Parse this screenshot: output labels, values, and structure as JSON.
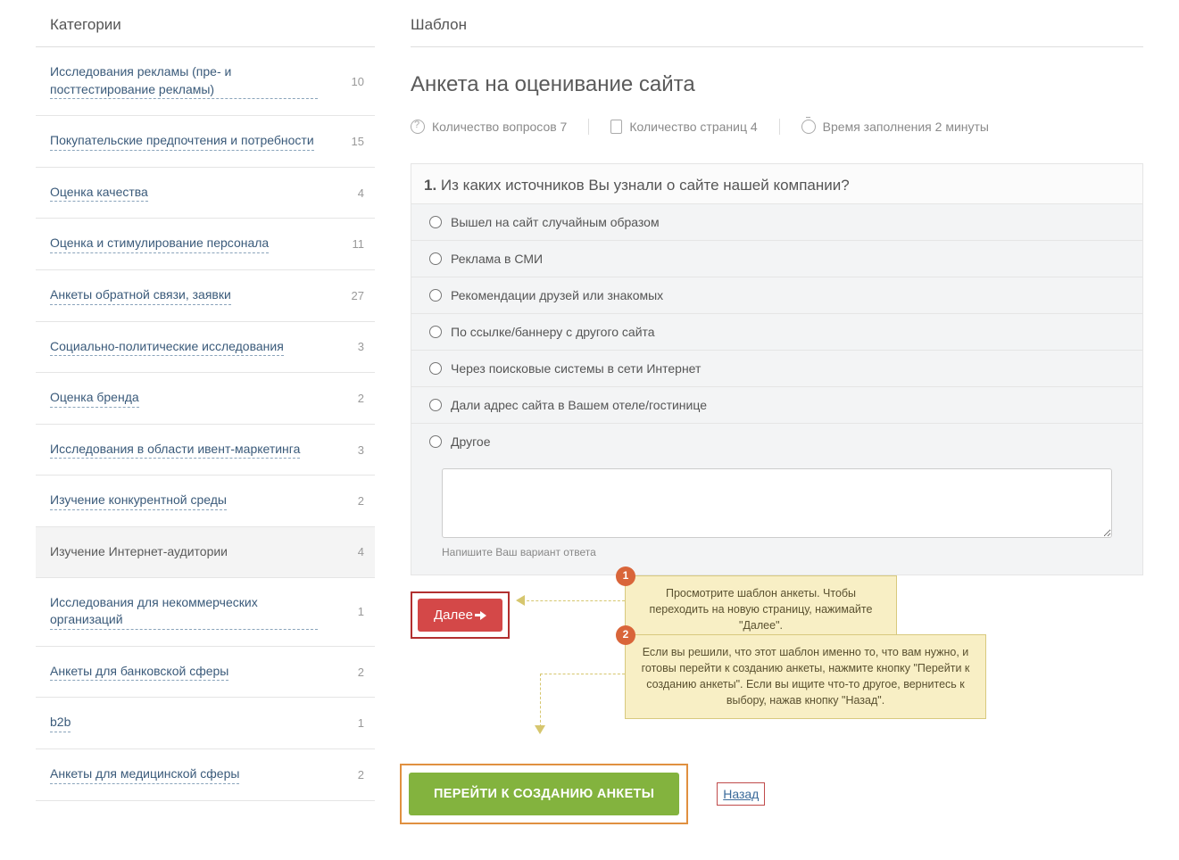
{
  "sidebar": {
    "title": "Категории",
    "items": [
      {
        "label": "Исследования рекламы (пре- и посттестирование рекламы)",
        "count": "10"
      },
      {
        "label": "Покупательские предпочтения и потребности",
        "count": "15"
      },
      {
        "label": "Оценка качества",
        "count": "4"
      },
      {
        "label": "Оценка и стимулирование персонала",
        "count": "11"
      },
      {
        "label": "Анкеты обратной связи, заявки",
        "count": "27"
      },
      {
        "label": "Социально-политические исследования",
        "count": "3"
      },
      {
        "label": "Оценка бренда",
        "count": "2"
      },
      {
        "label": "Исследования в области ивент-маркетинга",
        "count": "3"
      },
      {
        "label": "Изучение конкурентной среды",
        "count": "2"
      },
      {
        "label": "Изучение Интернет-аудитории",
        "count": "4"
      },
      {
        "label": "Исследования для некоммерческих организаций",
        "count": "1"
      },
      {
        "label": "Анкеты для банковской сферы",
        "count": "2"
      },
      {
        "label": "b2b",
        "count": "1"
      },
      {
        "label": "Анкеты для медицинской сферы",
        "count": "2"
      }
    ],
    "selected_index": 9
  },
  "main": {
    "section_title": "Шаблон",
    "title": "Анкета на оценивание сайта",
    "meta": {
      "questions_label": "Количество вопросов 7",
      "pages_label": "Количество страниц 4",
      "time_label": "Время заполнения 2 минуты"
    },
    "question": {
      "number": "1.",
      "text": "Из каких источников Вы узнали о сайте нашей компании?",
      "options": [
        "Вышел на сайт случайным образом",
        "Реклама в СМИ",
        "Рекомендации друзей или знакомых",
        "По ссылке/баннеру с другого сайта",
        "Через поисковые системы в сети Интернет",
        "Дали адрес сайта в Вашем отеле/гостинице",
        "Другое"
      ],
      "other_hint": "Напишите Ваш вариант ответа"
    },
    "next_label": "Далее",
    "create_label": "ПЕРЕЙТИ К СОЗДАНИЮ АНКЕТЫ",
    "back_label": "Назад",
    "callouts": {
      "b1": "1",
      "t1": "Просмотрите шаблон анкеты. Чтобы переходить на новую страницу, нажимайте \"Далее\".",
      "b2": "2",
      "t2": "Если вы решили, что этот шаблон именно то, что вам нужно, и готовы перейти к созданию анкеты, нажмите кнопку \"Перейти к созданию анкеты\". Если вы ищите что-то другое, вернитесь к выбору, нажав кнопку \"Назад\"."
    }
  }
}
